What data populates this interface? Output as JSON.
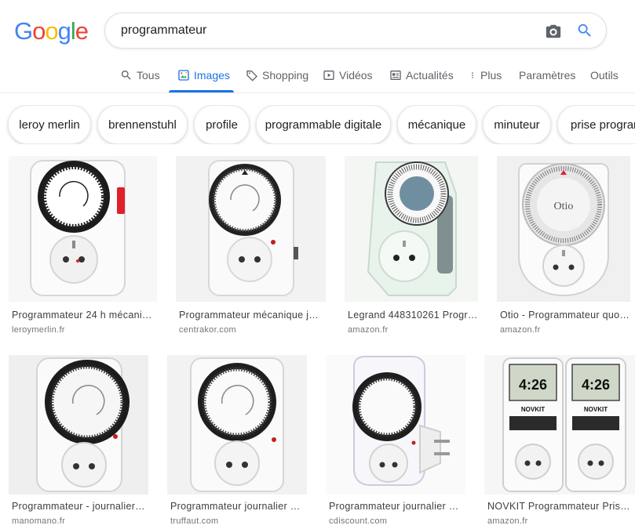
{
  "search": {
    "query": "programmateur"
  },
  "logo": {
    "letters": [
      "G",
      "o",
      "o",
      "g",
      "l",
      "e"
    ]
  },
  "tabs": [
    {
      "label": "Tous",
      "icon": "search-icon"
    },
    {
      "label": "Images",
      "icon": "image-icon"
    },
    {
      "label": "Shopping",
      "icon": "tag-icon"
    },
    {
      "label": "Vidéos",
      "icon": "play-icon"
    },
    {
      "label": "Actualités",
      "icon": "news-icon"
    },
    {
      "label": "Plus",
      "icon": "more-vert-icon"
    },
    {
      "label": "Paramètres"
    },
    {
      "label": "Outils"
    }
  ],
  "chips": [
    "leroy merlin",
    "brennenstuhl",
    "profile",
    "programmable digitale",
    "mécanique",
    "minuteur",
    "prise program"
  ],
  "results": [
    {
      "title": "Programmateur 24 h mécani…",
      "source": "leroymerlin.fr"
    },
    {
      "title": "Programmateur mécanique jo…",
      "source": "centrakor.com"
    },
    {
      "title": "Legrand 448310261 Progr…",
      "source": "amazon.fr"
    },
    {
      "title": "Otio - Programmateur quo…",
      "source": "amazon.fr",
      "brand_text": "Otio"
    },
    {
      "title": "Programmateur - journalier …",
      "source": "manomano.fr"
    },
    {
      "title": "Programmateur journalier p…",
      "source": "truffaut.com"
    },
    {
      "title": "Programmateur journalier …",
      "source": "cdiscount.com"
    },
    {
      "title": "NOVKIT Programmateur Prise…",
      "source": "amazon.fr",
      "brand_text": "NOVKIT",
      "display_text": "4:26"
    }
  ],
  "colors": {
    "accent": "#1a73e8",
    "google_blue": "#4285f4",
    "google_red": "#ea4335",
    "google_yellow": "#fbbc05",
    "google_green": "#34a853"
  }
}
